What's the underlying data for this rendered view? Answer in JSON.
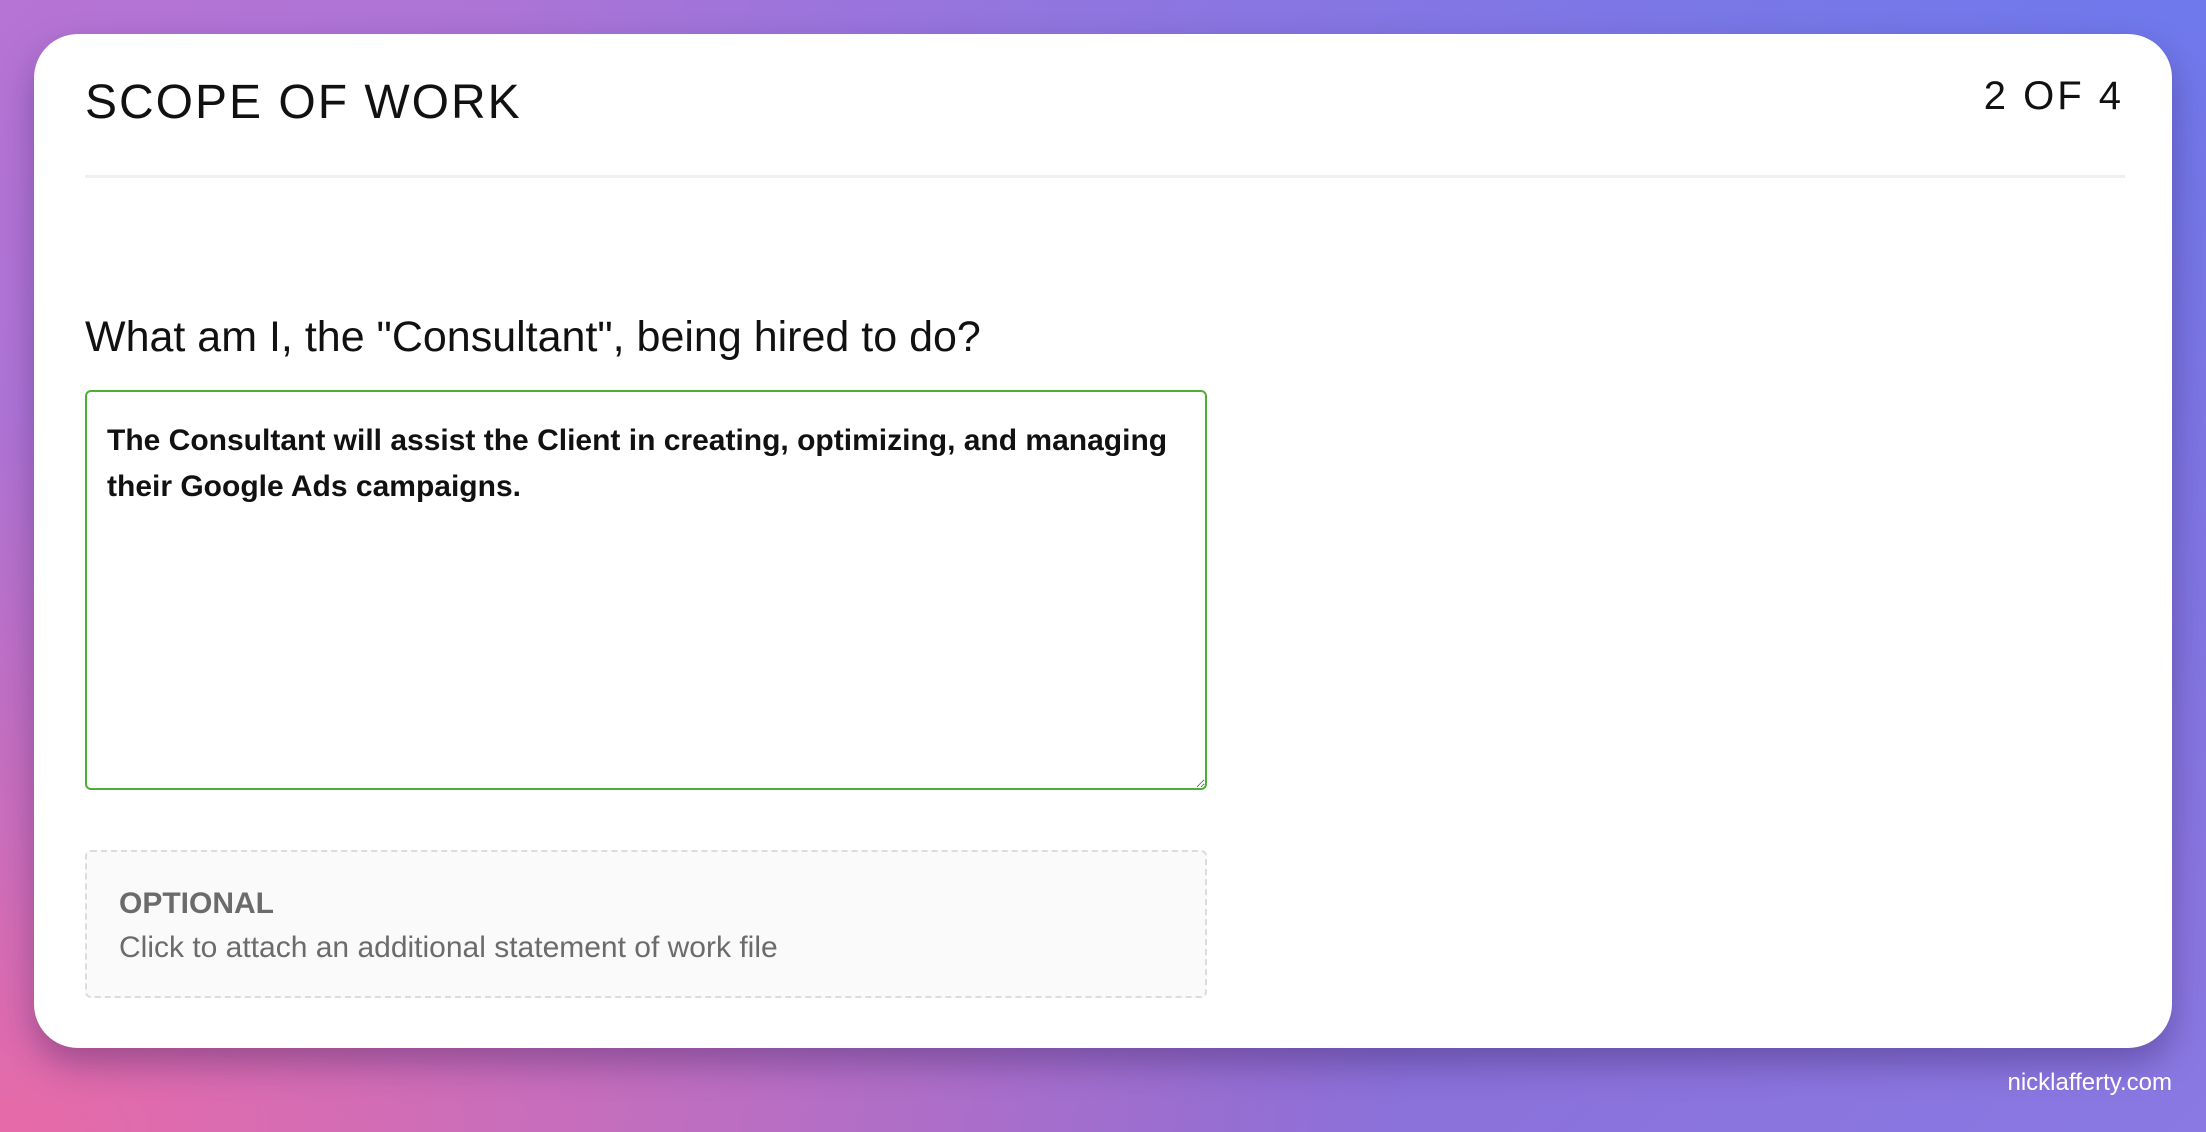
{
  "header": {
    "title": "SCOPE OF WORK",
    "step": "2 OF 4"
  },
  "form": {
    "question": "What am I, the \"Consultant\", being hired to do?",
    "answer_value": "The Consultant will assist the Client in creating, optimizing, and managing their Google Ads campaigns.",
    "attachment": {
      "label": "OPTIONAL",
      "text": "Click to attach an additional statement of work file"
    }
  },
  "footer": {
    "watermark": "nicklafferty.com"
  },
  "colors": {
    "input_border": "#4caf35",
    "card_background": "#ffffff",
    "muted_text": "#6b6b6b"
  }
}
